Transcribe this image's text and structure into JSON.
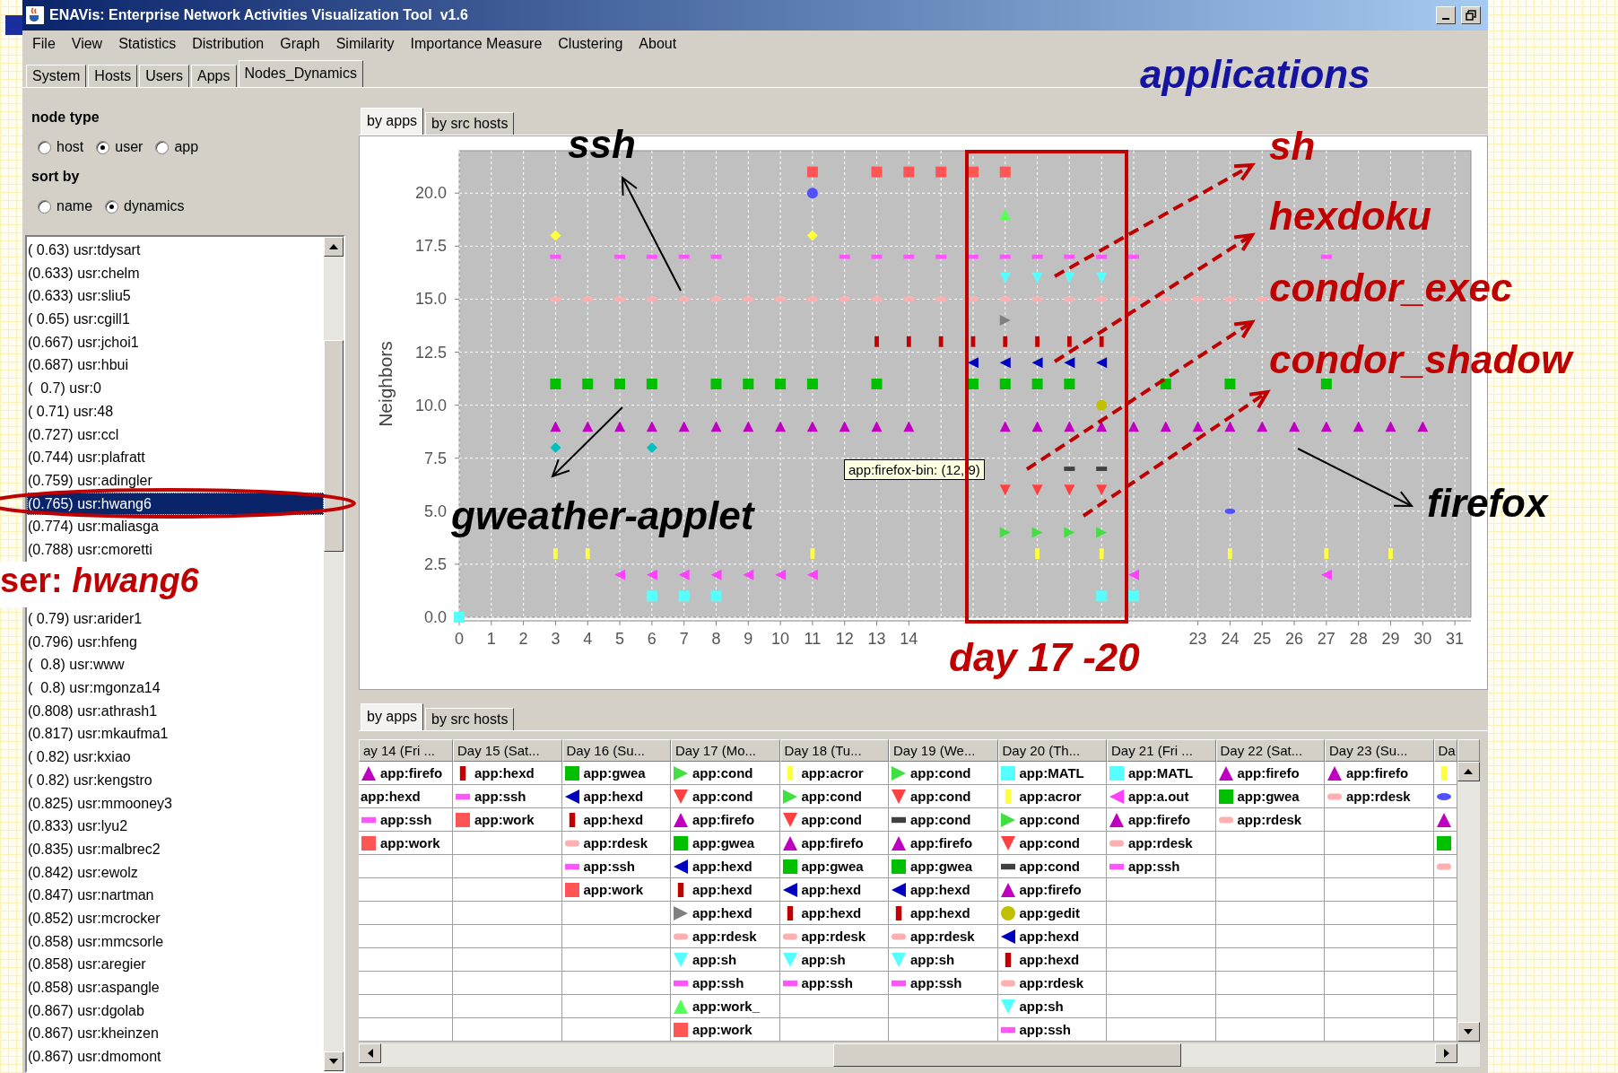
{
  "window": {
    "title": "ENAVis: Enterprise Network Activities Visualization Tool  v1.6"
  },
  "menu": [
    "File",
    "View",
    "Statistics",
    "Distribution",
    "Graph",
    "Similarity",
    "Importance Measure",
    "Clustering",
    "About"
  ],
  "tabs": [
    {
      "label": "System",
      "selected": false
    },
    {
      "label": "Hosts",
      "selected": false
    },
    {
      "label": "Users",
      "selected": false
    },
    {
      "label": "Apps",
      "selected": false
    },
    {
      "label": "Nodes_Dynamics",
      "selected": true
    }
  ],
  "node_panel": {
    "node_type": {
      "label": "node type",
      "options": [
        {
          "label": "host",
          "selected": false
        },
        {
          "label": "user",
          "selected": true
        },
        {
          "label": "app",
          "selected": false
        }
      ]
    },
    "sort_by": {
      "label": "sort by",
      "options": [
        {
          "label": "name",
          "selected": false
        },
        {
          "label": "dynamics",
          "selected": true
        }
      ]
    },
    "list": [
      {
        "kind": "item",
        "text": "( 0.63) usr:tdysart",
        "selected": false
      },
      {
        "kind": "item",
        "text": "(0.633) usr:chelm",
        "selected": false
      },
      {
        "kind": "item",
        "text": "(0.633) usr:sliu5",
        "selected": false
      },
      {
        "kind": "item",
        "text": "( 0.65) usr:cgill1",
        "selected": false
      },
      {
        "kind": "item",
        "text": "(0.667) usr:jchoi1",
        "selected": false
      },
      {
        "kind": "item",
        "text": "(0.687) usr:hbui",
        "selected": false
      },
      {
        "kind": "item",
        "text": "(  0.7) usr:0",
        "selected": false
      },
      {
        "kind": "item",
        "text": "( 0.71) usr:48",
        "selected": false
      },
      {
        "kind": "item",
        "text": "(0.727) usr:ccl",
        "selected": false
      },
      {
        "kind": "item",
        "text": "(0.744) usr:plafratt",
        "selected": false
      },
      {
        "kind": "item",
        "text": "(0.759) usr:adingler",
        "selected": false
      },
      {
        "kind": "item",
        "text": "(0.765) usr:hwang6",
        "selected": true
      },
      {
        "kind": "item",
        "text": "(0.774) usr:maliasga",
        "selected": false
      },
      {
        "kind": "item",
        "text": "(0.788) usr:cmoretti",
        "selected": false
      },
      {
        "kind": "callout",
        "text": "ser: *hwang6*",
        "color": "#c00000"
      },
      {
        "kind": "item",
        "text": "( 0.79) usr:arider1",
        "selected": false
      },
      {
        "kind": "item",
        "text": "(0.796) usr:hfeng",
        "selected": false
      },
      {
        "kind": "item",
        "text": "(  0.8) usr:www",
        "selected": false
      },
      {
        "kind": "item",
        "text": "(  0.8) usr:mgonza14",
        "selected": false
      },
      {
        "kind": "item",
        "text": "(0.808) usr:athrash1",
        "selected": false
      },
      {
        "kind": "item",
        "text": "(0.817) usr:mkaufma1",
        "selected": false
      },
      {
        "kind": "item",
        "text": "( 0.82) usr:kxiao",
        "selected": false
      },
      {
        "kind": "item",
        "text": "( 0.82) usr:kengstro",
        "selected": false
      },
      {
        "kind": "item",
        "text": "(0.825) usr:mmooney3",
        "selected": false
      },
      {
        "kind": "item",
        "text": "(0.833) usr:lyu2",
        "selected": false
      },
      {
        "kind": "item",
        "text": "(0.835) usr:malbrec2",
        "selected": false
      },
      {
        "kind": "item",
        "text": "(0.842) usr:ewolz",
        "selected": false
      },
      {
        "kind": "item",
        "text": "(0.847) usr:nartman",
        "selected": false
      },
      {
        "kind": "item",
        "text": "(0.852) usr:mcrocker",
        "selected": false
      },
      {
        "kind": "item",
        "text": "(0.858) usr:mmcsorle",
        "selected": false
      },
      {
        "kind": "item",
        "text": "(0.858) usr:aregier",
        "selected": false
      },
      {
        "kind": "item",
        "text": "(0.858) usr:aspangle",
        "selected": false
      },
      {
        "kind": "item",
        "text": "(0.867) usr:dgolab",
        "selected": false
      },
      {
        "kind": "item",
        "text": "(0.867) usr:kheinzen",
        "selected": false
      },
      {
        "kind": "item",
        "text": "(0.867) usr:dmomont",
        "selected": false
      }
    ]
  },
  "chart_panel": {
    "tabs": [
      {
        "label": "by apps",
        "selected": true
      },
      {
        "label": "by src hosts",
        "selected": false
      }
    ],
    "tooltip": "app:firefox-bin: (12, 9)",
    "chart_data": {
      "type": "scatter",
      "ylabel": "Neighbors",
      "xlim": [
        0,
        31.5
      ],
      "ylim": [
        0,
        22
      ],
      "xticks": [
        0,
        1,
        2,
        3,
        4,
        5,
        6,
        7,
        8,
        9,
        10,
        11,
        12,
        13,
        14,
        23,
        24,
        25,
        26,
        27,
        28,
        29,
        30,
        31
      ],
      "grid": true,
      "yticks": [
        {
          "value": 0,
          "label": "0.0"
        },
        {
          "value": 2.5,
          "label": "2.5"
        },
        {
          "value": 5,
          "label": "5.0"
        },
        {
          "value": 7.5,
          "label": "7.5"
        },
        {
          "value": 10,
          "label": "10.0"
        },
        {
          "value": 12.5,
          "label": "12.5"
        },
        {
          "value": 15,
          "label": "15.0"
        },
        {
          "value": 17.5,
          "label": "17.5"
        },
        {
          "value": 20,
          "label": "20.0"
        }
      ],
      "series": [
        {
          "color": "#ff5555",
          "x": [
            11,
            13,
            14,
            15,
            16,
            17
          ],
          "values": [
            21,
            21,
            21,
            21,
            21,
            21
          ]
        },
        {
          "color": "#5050ff",
          "x": [
            11
          ],
          "values": [
            20
          ]
        },
        {
          "color": "#5050ff",
          "x": [
            24
          ],
          "values": [
            5
          ]
        },
        {
          "color": "#ffff40",
          "x": [
            3,
            11
          ],
          "values": [
            18,
            18
          ]
        },
        {
          "color": "#55ff55",
          "x": [
            17
          ],
          "values": [
            19
          ]
        },
        {
          "color": "#ff55ff",
          "x": [
            3,
            5,
            6,
            7,
            8,
            12,
            13,
            14,
            15,
            16,
            17,
            18,
            19,
            20,
            21,
            27
          ],
          "values": [
            17,
            17,
            17,
            17,
            17,
            17,
            17,
            17,
            17,
            17,
            17,
            17,
            17,
            17,
            17,
            17
          ]
        },
        {
          "color": "#55ffff",
          "x": [
            17,
            18,
            19,
            20
          ],
          "values": [
            16,
            16,
            16,
            16
          ]
        },
        {
          "color": "#ffafaf",
          "x": [
            3,
            4,
            5,
            6,
            7,
            8,
            9,
            10,
            11,
            12,
            13,
            14,
            15,
            16,
            17,
            18,
            19,
            20,
            21,
            22,
            23,
            24,
            25
          ],
          "values": [
            15,
            15,
            15,
            15,
            15,
            15,
            15,
            15,
            15,
            15,
            15,
            15,
            15,
            15,
            15,
            15,
            15,
            15,
            15,
            15,
            15,
            15,
            15
          ]
        },
        {
          "color": "#808080",
          "x": [
            17
          ],
          "values": [
            14
          ]
        },
        {
          "color": "#c00000",
          "x": [
            13,
            14,
            15,
            16,
            17,
            18,
            19,
            20
          ],
          "values": [
            13,
            13,
            13,
            13,
            13,
            13,
            13,
            13
          ]
        },
        {
          "color": "#0000c0",
          "x": [
            16,
            17,
            18,
            19,
            20
          ],
          "values": [
            12,
            12,
            12,
            12,
            12
          ]
        },
        {
          "color": "#00c000",
          "x": [
            3,
            4,
            5,
            6,
            8,
            9,
            10,
            11,
            13,
            16,
            17,
            18,
            19,
            22,
            24,
            27
          ],
          "values": [
            11,
            11,
            11,
            11,
            11,
            11,
            11,
            11,
            11,
            11,
            11,
            11,
            11,
            11,
            11,
            11
          ]
        },
        {
          "color": "#c0c000",
          "x": [
            20
          ],
          "values": [
            10
          ]
        },
        {
          "color": "#c000c0",
          "x": [
            3,
            4,
            5,
            6,
            7,
            8,
            9,
            10,
            11,
            12,
            13,
            14,
            17,
            18,
            19,
            20,
            21,
            22,
            23,
            24,
            25,
            26,
            27,
            28,
            29,
            30
          ],
          "values": [
            9,
            9,
            9,
            9,
            9,
            9,
            9,
            9,
            9,
            9,
            9,
            9,
            9,
            9,
            9,
            9,
            9,
            9,
            9,
            9,
            9,
            9,
            9,
            9,
            9,
            9
          ]
        },
        {
          "color": "#00c0c0",
          "x": [
            3,
            6
          ],
          "values": [
            8,
            8
          ]
        },
        {
          "color": "#404040",
          "x": [
            19,
            20
          ],
          "values": [
            7,
            7
          ]
        },
        {
          "color": "#ff4040",
          "x": [
            17,
            18,
            19,
            20
          ],
          "values": [
            6,
            6,
            6,
            6
          ]
        },
        {
          "color": "#40e040",
          "x": [
            17,
            18,
            19,
            20
          ],
          "values": [
            4,
            4,
            4,
            4
          ]
        },
        {
          "color": "#ffff40",
          "x": [
            3,
            4,
            11,
            18,
            20,
            24,
            27,
            29
          ],
          "values": [
            3,
            3,
            3,
            3,
            3,
            3,
            3,
            3
          ]
        },
        {
          "color": "#ff40ff",
          "x": [
            5,
            6,
            7,
            8,
            9,
            10,
            11,
            21,
            27
          ],
          "values": [
            2,
            2,
            2,
            2,
            2,
            2,
            2,
            2,
            2
          ]
        },
        {
          "color": "#55ffff",
          "x": [
            0,
            6,
            7,
            8,
            20,
            21
          ],
          "values": [
            0,
            1,
            1,
            1,
            1,
            1
          ]
        }
      ]
    }
  },
  "table_panel": {
    "tabs": [
      {
        "label": "by apps",
        "selected": true
      },
      {
        "label": "by src hosts",
        "selected": false
      }
    ],
    "columns": [
      {
        "header": "ay 14 (Fri ...",
        "cells": [
          {
            "kind": "tri-up",
            "color": "#c000c0",
            "text": "app:firefo"
          },
          {
            "text": "app:hexd"
          },
          {
            "kind": "dash",
            "color": "#ff55ff",
            "text": "app:ssh"
          },
          {
            "kind": "square",
            "color": "#ff5555",
            "text": "app:work"
          }
        ]
      },
      {
        "header": "Day 15 (Sat...",
        "cells": [
          {
            "kind": "bar",
            "color": "#c00000",
            "text": "app:hexd"
          },
          {
            "kind": "dash",
            "color": "#ff55ff",
            "text": "app:ssh"
          },
          {
            "kind": "square",
            "color": "#ff5555",
            "text": "app:work"
          }
        ]
      },
      {
        "header": "Day 16 (Su...",
        "cells": [
          {
            "kind": "square",
            "color": "#00c000",
            "text": "app:gwea"
          },
          {
            "kind": "tri-left",
            "color": "#0000c0",
            "text": "app:hexd"
          },
          {
            "kind": "bar",
            "color": "#c00000",
            "text": "app:hexd"
          },
          {
            "kind": "pill",
            "color": "#ffafaf",
            "text": "app:rdesk"
          },
          {
            "kind": "dash",
            "color": "#ff55ff",
            "text": "app:ssh"
          },
          {
            "kind": "square",
            "color": "#ff5555",
            "text": "app:work"
          }
        ]
      },
      {
        "header": "Day 17 (Mo...",
        "cells": [
          {
            "kind": "tri-right",
            "color": "#40e040",
            "text": "app:cond"
          },
          {
            "kind": "tri-down",
            "color": "#ff4040",
            "text": "app:cond"
          },
          {
            "kind": "tri-up",
            "color": "#c000c0",
            "text": "app:firefo"
          },
          {
            "kind": "square",
            "color": "#00c000",
            "text": "app:gwea"
          },
          {
            "kind": "tri-left",
            "color": "#0000c0",
            "text": "app:hexd"
          },
          {
            "kind": "bar",
            "color": "#c00000",
            "text": "app:hexd"
          },
          {
            "kind": "tri-right",
            "color": "#808080",
            "text": "app:hexd"
          },
          {
            "kind": "pill",
            "color": "#ffafaf",
            "text": "app:rdesk"
          },
          {
            "kind": "tri-down",
            "color": "#55ffff",
            "text": "app:sh"
          },
          {
            "kind": "dash",
            "color": "#ff55ff",
            "text": "app:ssh"
          },
          {
            "kind": "tri-up",
            "color": "#55ff55",
            "text": "app:work_"
          },
          {
            "kind": "square",
            "color": "#ff5555",
            "text": "app:work"
          }
        ]
      },
      {
        "header": "Day 18 (Tu...",
        "cells": [
          {
            "kind": "bar",
            "color": "#ffff40",
            "text": "app:acror"
          },
          {
            "kind": "tri-right",
            "color": "#40e040",
            "text": "app:cond"
          },
          {
            "kind": "tri-down",
            "color": "#ff4040",
            "text": "app:cond"
          },
          {
            "kind": "tri-up",
            "color": "#c000c0",
            "text": "app:firefo"
          },
          {
            "kind": "square",
            "color": "#00c000",
            "text": "app:gwea"
          },
          {
            "kind": "tri-left",
            "color": "#0000c0",
            "text": "app:hexd"
          },
          {
            "kind": "bar",
            "color": "#c00000",
            "text": "app:hexd"
          },
          {
            "kind": "pill",
            "color": "#ffafaf",
            "text": "app:rdesk"
          },
          {
            "kind": "tri-down",
            "color": "#55ffff",
            "text": "app:sh"
          },
          {
            "kind": "dash",
            "color": "#ff55ff",
            "text": "app:ssh"
          }
        ]
      },
      {
        "header": "Day 19 (We...",
        "cells": [
          {
            "kind": "tri-right",
            "color": "#40e040",
            "text": "app:cond"
          },
          {
            "kind": "tri-down",
            "color": "#ff4040",
            "text": "app:cond"
          },
          {
            "kind": "dash",
            "color": "#404040",
            "text": "app:cond"
          },
          {
            "kind": "tri-up",
            "color": "#c000c0",
            "text": "app:firefo"
          },
          {
            "kind": "square",
            "color": "#00c000",
            "text": "app:gwea"
          },
          {
            "kind": "tri-left",
            "color": "#0000c0",
            "text": "app:hexd"
          },
          {
            "kind": "bar",
            "color": "#c00000",
            "text": "app:hexd"
          },
          {
            "kind": "pill",
            "color": "#ffafaf",
            "text": "app:rdesk"
          },
          {
            "kind": "tri-down",
            "color": "#55ffff",
            "text": "app:sh"
          },
          {
            "kind": "dash",
            "color": "#ff55ff",
            "text": "app:ssh"
          }
        ]
      },
      {
        "header": "Day 20 (Th...",
        "cells": [
          {
            "kind": "square",
            "color": "#55ffff",
            "text": "app:MATL"
          },
          {
            "kind": "bar",
            "color": "#ffff40",
            "text": "app:acror"
          },
          {
            "kind": "tri-right",
            "color": "#40e040",
            "text": "app:cond"
          },
          {
            "kind": "tri-down",
            "color": "#ff4040",
            "text": "app:cond"
          },
          {
            "kind": "dash",
            "color": "#404040",
            "text": "app:cond"
          },
          {
            "kind": "tri-up",
            "color": "#c000c0",
            "text": "app:firefo"
          },
          {
            "kind": "circle",
            "color": "#c0c000",
            "text": "app:gedit"
          },
          {
            "kind": "tri-left",
            "color": "#0000c0",
            "text": "app:hexd"
          },
          {
            "kind": "bar",
            "color": "#c00000",
            "text": "app:hexd"
          },
          {
            "kind": "pill",
            "color": "#ffafaf",
            "text": "app:rdesk"
          },
          {
            "kind": "tri-down",
            "color": "#55ffff",
            "text": "app:sh"
          },
          {
            "kind": "dash",
            "color": "#ff55ff",
            "text": "app:ssh"
          }
        ]
      },
      {
        "header": "Day 21 (Fri ...",
        "cells": [
          {
            "kind": "square",
            "color": "#55ffff",
            "text": "app:MATL"
          },
          {
            "kind": "tri-left",
            "color": "#ff40ff",
            "text": "app:a.out"
          },
          {
            "kind": "tri-up",
            "color": "#c000c0",
            "text": "app:firefo"
          },
          {
            "kind": "pill",
            "color": "#ffafaf",
            "text": "app:rdesk"
          },
          {
            "kind": "dash",
            "color": "#ff55ff",
            "text": "app:ssh"
          }
        ]
      },
      {
        "header": "Day 22 (Sat...",
        "cells": [
          {
            "kind": "tri-up",
            "color": "#c000c0",
            "text": "app:firefo"
          },
          {
            "kind": "square",
            "color": "#00c000",
            "text": "app:gwea"
          },
          {
            "kind": "pill",
            "color": "#ffafaf",
            "text": "app:rdesk"
          }
        ]
      },
      {
        "header": "Day 23 (Su...",
        "cells": [
          {
            "kind": "tri-up",
            "color": "#c000c0",
            "text": "app:firefo"
          },
          {
            "kind": "pill",
            "color": "#ffafaf",
            "text": "app:rdesk"
          }
        ]
      },
      {
        "header": "Da",
        "cells": [
          {
            "kind": "bar",
            "color": "#ffff40"
          },
          {
            "kind": "ellipse",
            "color": "#5050ff"
          },
          {
            "kind": "tri-up",
            "color": "#c000c0"
          },
          {
            "kind": "square",
            "color": "#00c000"
          },
          {
            "kind": "pill",
            "color": "#ffafaf"
          }
        ]
      }
    ]
  },
  "annotations": [
    {
      "text": "applications",
      "color": "#1414a0"
    },
    {
      "text": "ssh",
      "color": "#000000"
    },
    {
      "text": "sh",
      "color": "#c00000"
    },
    {
      "text": "hexdoku",
      "color": "#c00000"
    },
    {
      "text": "condor_exec",
      "color": "#c00000"
    },
    {
      "text": "condor_shadow",
      "color": "#c00000"
    },
    {
      "text": "gweather-applet",
      "color": "#000000"
    },
    {
      "text": "firefox",
      "color": "#000000"
    },
    {
      "text": "day 17 -20",
      "color": "#c00000"
    }
  ]
}
